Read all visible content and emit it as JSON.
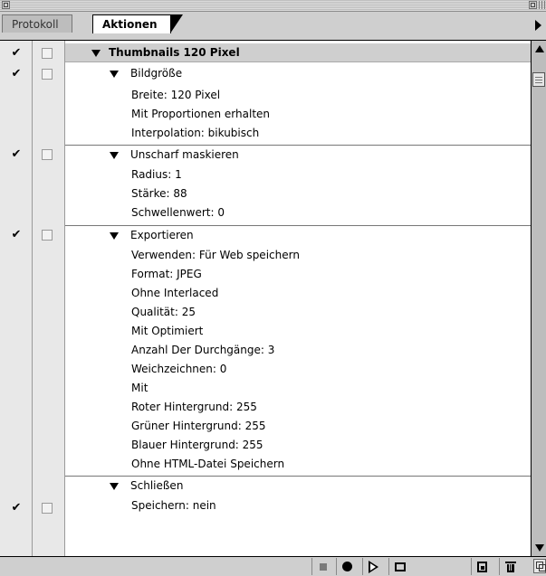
{
  "tabs": {
    "history": "Protokoll",
    "actions": "Aktionen"
  },
  "check_glyph": "✔",
  "actions": {
    "set_name": "Thumbnails 120 Pixel",
    "commands": [
      {
        "name": "Bildgröße",
        "params": [
          "Breite: 120 Pixel",
          "Mit Proportionen erhalten",
          "Interpolation: bikubisch"
        ]
      },
      {
        "name": "Unscharf maskieren",
        "params": [
          "Radius: 1",
          "Stärke: 88",
          "Schwellenwert: 0"
        ]
      },
      {
        "name": "Exportieren",
        "params": [
          "Verwenden: Für Web speichern",
          "Format: JPEG",
          " Ohne Interlaced",
          "Qualität: 25",
          "Mit Optimiert",
          "Anzahl Der Durchgänge: 3",
          "Weichzeichnen: 0",
          "Mit",
          "Roter Hintergrund: 255",
          "Grüner Hintergrund: 255",
          "Blauer Hintergrund: 255",
          " Ohne HTML-Datei Speichern"
        ]
      },
      {
        "name": "Schließen",
        "params": [
          "Speichern: nein"
        ]
      }
    ]
  },
  "colors": {
    "panel_bg": "#cfcfcf",
    "column_bg": "#e8e8e8",
    "set_row_bg": "#cfcfcf"
  }
}
